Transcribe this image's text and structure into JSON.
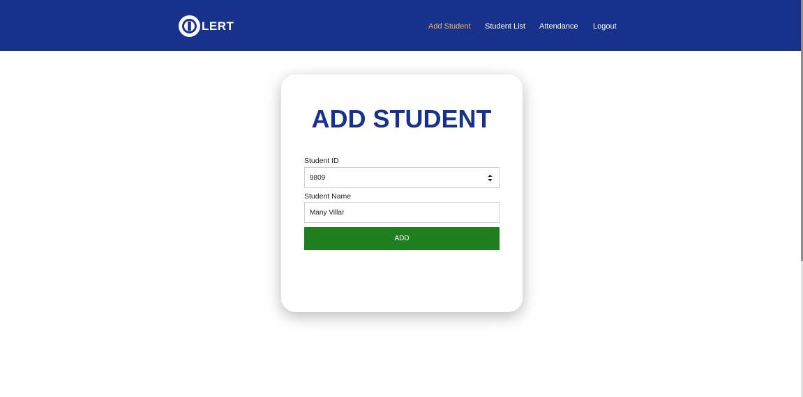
{
  "brand": {
    "logo_text": "LERT",
    "logo_icon": "circle-i-logo-icon"
  },
  "nav": {
    "items": [
      {
        "label": "Add Student",
        "active": true
      },
      {
        "label": "Student List",
        "active": false
      },
      {
        "label": "Attendance",
        "active": false
      },
      {
        "label": "Logout",
        "active": false
      }
    ]
  },
  "form": {
    "title": "ADD STUDENT",
    "student_id": {
      "label": "Student ID",
      "value": "9809"
    },
    "student_name": {
      "label": "Student Name",
      "value": "Many Villar"
    },
    "submit_label": "ADD"
  },
  "colors": {
    "navbar": "#18328c",
    "active_nav": "#f0b65a",
    "title": "#18328c",
    "button": "#1f7f1f"
  }
}
